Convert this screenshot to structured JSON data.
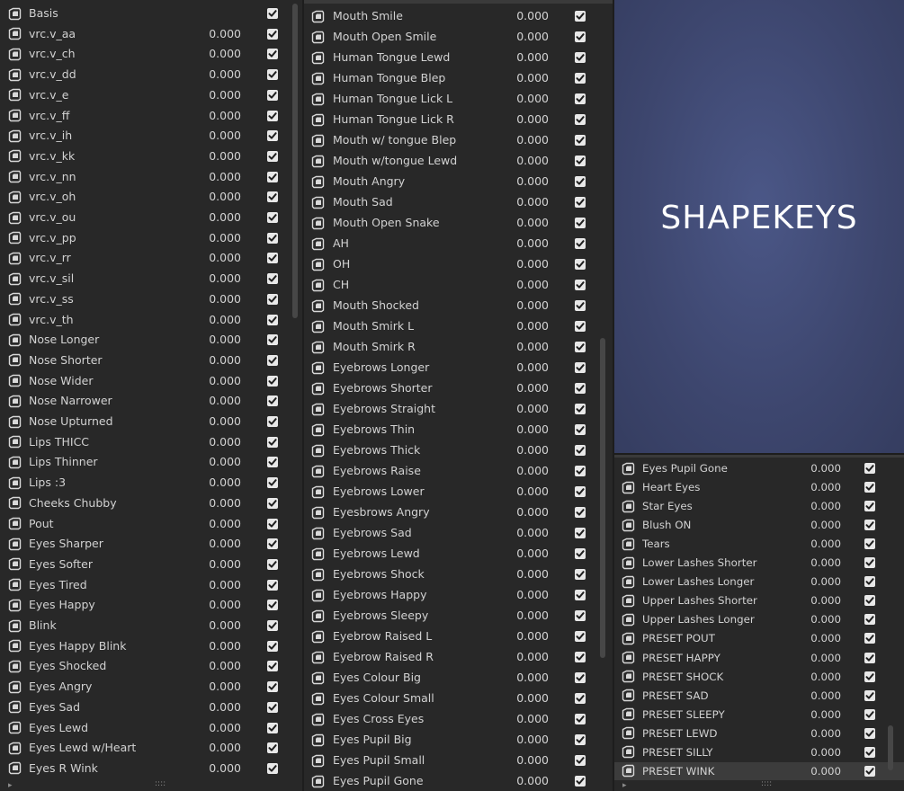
{
  "preview": {
    "title": "SHAPEKEYS"
  },
  "columns": [
    {
      "rows": [
        {
          "name": "Basis",
          "value": ""
        },
        {
          "name": "vrc.v_aa",
          "value": "0.000"
        },
        {
          "name": "vrc.v_ch",
          "value": "0.000"
        },
        {
          "name": "vrc.v_dd",
          "value": "0.000"
        },
        {
          "name": "vrc.v_e",
          "value": "0.000"
        },
        {
          "name": "vrc.v_ff",
          "value": "0.000"
        },
        {
          "name": "vrc.v_ih",
          "value": "0.000"
        },
        {
          "name": "vrc.v_kk",
          "value": "0.000"
        },
        {
          "name": "vrc.v_nn",
          "value": "0.000"
        },
        {
          "name": "vrc.v_oh",
          "value": "0.000"
        },
        {
          "name": "vrc.v_ou",
          "value": "0.000"
        },
        {
          "name": "vrc.v_pp",
          "value": "0.000"
        },
        {
          "name": "vrc.v_rr",
          "value": "0.000"
        },
        {
          "name": "vrc.v_sil",
          "value": "0.000"
        },
        {
          "name": "vrc.v_ss",
          "value": "0.000"
        },
        {
          "name": "vrc.v_th",
          "value": "0.000"
        },
        {
          "name": "Nose Longer",
          "value": "0.000"
        },
        {
          "name": "Nose Shorter",
          "value": "0.000"
        },
        {
          "name": "Nose Wider",
          "value": "0.000"
        },
        {
          "name": "Nose Narrower",
          "value": "0.000"
        },
        {
          "name": "Nose Upturned",
          "value": "0.000"
        },
        {
          "name": "Lips THICC",
          "value": "0.000"
        },
        {
          "name": "Lips Thinner",
          "value": "0.000"
        },
        {
          "name": "Lips :3",
          "value": "0.000"
        },
        {
          "name": "Cheeks Chubby",
          "value": "0.000"
        },
        {
          "name": "Pout",
          "value": "0.000"
        },
        {
          "name": "Eyes Sharper",
          "value": "0.000"
        },
        {
          "name": "Eyes Softer",
          "value": "0.000"
        },
        {
          "name": "Eyes Tired",
          "value": "0.000"
        },
        {
          "name": "Eyes Happy",
          "value": "0.000"
        },
        {
          "name": "Blink",
          "value": "0.000"
        },
        {
          "name": "Eyes Happy Blink",
          "value": "0.000"
        },
        {
          "name": "Eyes Shocked",
          "value": "0.000"
        },
        {
          "name": "Eyes Angry",
          "value": "0.000"
        },
        {
          "name": "Eyes Sad",
          "value": "0.000"
        },
        {
          "name": "Eyes Lewd",
          "value": "0.000"
        },
        {
          "name": "Eyes Lewd w/Heart",
          "value": "0.000"
        },
        {
          "name": "Eyes R Wink",
          "value": "0.000"
        }
      ]
    },
    {
      "rows": [
        {
          "name": "Mouth Smile",
          "value": "0.000"
        },
        {
          "name": "Mouth Open Smile",
          "value": "0.000"
        },
        {
          "name": "Human Tongue Lewd",
          "value": "0.000"
        },
        {
          "name": "Human Tongue Blep",
          "value": "0.000"
        },
        {
          "name": "Human Tongue Lick L",
          "value": "0.000"
        },
        {
          "name": "Human Tongue Lick R",
          "value": "0.000"
        },
        {
          "name": "Mouth w/ tongue Blep",
          "value": "0.000"
        },
        {
          "name": "Mouth w/tongue Lewd",
          "value": "0.000"
        },
        {
          "name": "Mouth Angry",
          "value": "0.000"
        },
        {
          "name": "Mouth Sad",
          "value": "0.000"
        },
        {
          "name": "Mouth Open Snake",
          "value": "0.000"
        },
        {
          "name": "AH",
          "value": "0.000"
        },
        {
          "name": "OH",
          "value": "0.000"
        },
        {
          "name": "CH",
          "value": "0.000"
        },
        {
          "name": "Mouth Shocked",
          "value": "0.000"
        },
        {
          "name": "Mouth Smirk L",
          "value": "0.000"
        },
        {
          "name": "Mouth Smirk R",
          "value": "0.000"
        },
        {
          "name": "Eyebrows Longer",
          "value": "0.000"
        },
        {
          "name": "Eyebrows Shorter",
          "value": "0.000"
        },
        {
          "name": "Eyebrows Straight",
          "value": "0.000"
        },
        {
          "name": "Eyebrows Thin",
          "value": "0.000"
        },
        {
          "name": "Eyebrows Thick",
          "value": "0.000"
        },
        {
          "name": "Eyebrows Raise",
          "value": "0.000"
        },
        {
          "name": "Eyebrows Lower",
          "value": "0.000"
        },
        {
          "name": "Eyesbrows Angry",
          "value": "0.000"
        },
        {
          "name": "Eyebrows Sad",
          "value": "0.000"
        },
        {
          "name": "Eyebrows Lewd",
          "value": "0.000"
        },
        {
          "name": "Eyebrows Shock",
          "value": "0.000"
        },
        {
          "name": "Eyebrows Happy",
          "value": "0.000"
        },
        {
          "name": "Eyebrows Sleepy",
          "value": "0.000"
        },
        {
          "name": "Eyebrow Raised L",
          "value": "0.000"
        },
        {
          "name": "Eyebrow Raised R",
          "value": "0.000"
        },
        {
          "name": "Eyes Colour Big",
          "value": "0.000"
        },
        {
          "name": "Eyes Colour Small",
          "value": "0.000"
        },
        {
          "name": "Eyes Cross Eyes",
          "value": "0.000"
        },
        {
          "name": "Eyes Pupil Big",
          "value": "0.000"
        },
        {
          "name": "Eyes Pupil Small",
          "value": "0.000"
        },
        {
          "name": "Eyes Pupil Gone",
          "value": "0.000"
        }
      ]
    },
    {
      "rows": [
        {
          "name": "Eyes Pupil Gone",
          "value": "0.000"
        },
        {
          "name": "Heart Eyes",
          "value": "0.000"
        },
        {
          "name": "Star Eyes",
          "value": "0.000"
        },
        {
          "name": "Blush ON",
          "value": "0.000"
        },
        {
          "name": "Tears",
          "value": "0.000"
        },
        {
          "name": "Lower Lashes Shorter",
          "value": "0.000"
        },
        {
          "name": "Lower Lashes Longer",
          "value": "0.000"
        },
        {
          "name": "Upper Lashes Shorter",
          "value": "0.000"
        },
        {
          "name": "Upper Lashes Longer",
          "value": "0.000"
        },
        {
          "name": "PRESET POUT",
          "value": "0.000"
        },
        {
          "name": "PRESET HAPPY",
          "value": "0.000"
        },
        {
          "name": "PRESET SHOCK",
          "value": "0.000"
        },
        {
          "name": "PRESET SAD",
          "value": "0.000"
        },
        {
          "name": "PRESET SLEEPY",
          "value": "0.000"
        },
        {
          "name": "PRESET LEWD",
          "value": "0.000"
        },
        {
          "name": "PRESET SILLY",
          "value": "0.000"
        },
        {
          "name": "PRESET WINK",
          "value": "0.000",
          "active": true
        }
      ]
    }
  ],
  "footer": {
    "expand_glyph": "▸",
    "grip_glyph": "::::"
  },
  "icon": "shape-key-icon",
  "checkbox_checked": true
}
